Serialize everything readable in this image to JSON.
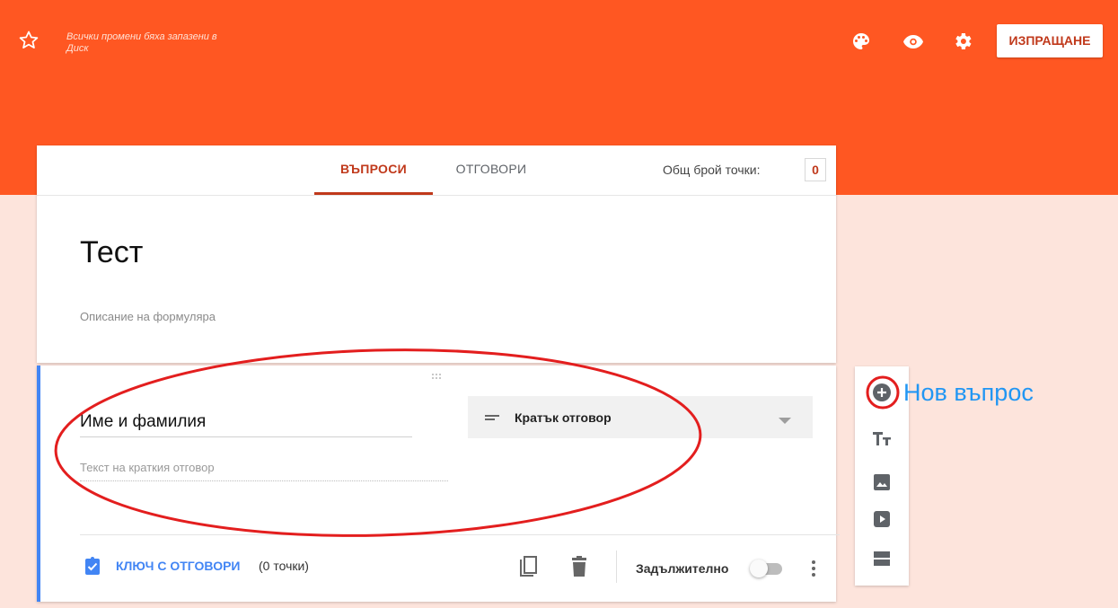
{
  "header": {
    "saved_status": "Всички промени бяха запазени в Диск",
    "send_label": "ИЗПРАЩАНЕ"
  },
  "tabs": {
    "questions": "ВЪПРОСИ",
    "responses": "ОТГОВОРИ"
  },
  "points": {
    "label": "Общ брой точки:",
    "value": "0"
  },
  "form": {
    "title": "Тест",
    "description_placeholder": "Описание на формуляра"
  },
  "question": {
    "title": "Име и фамилия",
    "answer_placeholder": "Текст на краткия отговор",
    "type": "Кратък отговор",
    "answer_key_label": "КЛЮЧ С ОТГОВОРИ",
    "points_note": "(0 точки)",
    "required_label": "Задължително",
    "required": false
  },
  "annotation": {
    "new_question": "Нов въпрос"
  },
  "colors": {
    "header": "#ff5722",
    "page_bg": "#fde4dc",
    "accent": "#c0391b",
    "question_border": "#4285f4",
    "annotation_red": "#e31e1e",
    "annotation_blue": "#2196f3"
  },
  "icons": {
    "star": "star-outline-icon",
    "palette": "palette-icon",
    "preview": "eye-icon",
    "settings": "gear-icon",
    "short_answer": "short-text-icon",
    "dropdown": "arrow-drop-down-icon",
    "answer_key": "checkbox-icon",
    "copy": "copy-icon",
    "delete": "trash-icon",
    "more": "more-vert-icon",
    "add_question": "add-circle-icon",
    "add_title": "text-title-icon",
    "add_image": "image-icon",
    "add_video": "video-icon",
    "add_section": "section-icon"
  }
}
